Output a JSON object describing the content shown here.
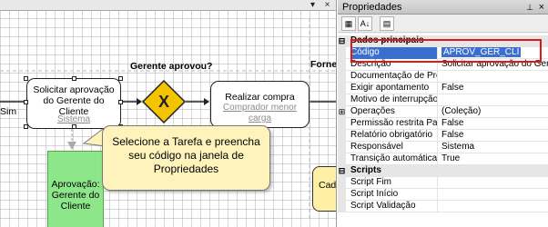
{
  "canvas": {
    "close_glyph": "×",
    "menu_glyph": "▾",
    "gateway_question": "Gerente aprovou?",
    "lane_left": "Sim",
    "lane_right": "Forne",
    "task1": {
      "title": "Solicitar aprovação do Gerente do Cliente",
      "subtitle": "Sistema"
    },
    "gateway_symbol": "X",
    "task2": {
      "title": "Realizar compra",
      "subtitle": "Comprador menor carga"
    },
    "green_box_label": "Aprovação: Gerente do Cliente",
    "callout_text": "Selecione a Tarefa e preencha seu código na janela de Propriedades",
    "yellow_task_label": "Cad"
  },
  "panel": {
    "title": "Propriedades",
    "pin_glyph": "📌",
    "close_glyph": "×",
    "toolbar": {
      "categorized_icon": "categorized-icon",
      "alphabetical_icon": "alphabetical-icon",
      "properties_icon": "property-pages-icon"
    },
    "categories": [
      {
        "name": "Dados principais",
        "expander": "⊟"
      },
      {
        "name": "Scripts",
        "expander": "⊟"
      }
    ],
    "rows": [
      {
        "name": "Código",
        "value": "APROV_GER_CLI",
        "selected": true
      },
      {
        "name": "Descrição",
        "value": "Solicitar aprovação do Gerente"
      },
      {
        "name": "Documentação de Proce",
        "value": ""
      },
      {
        "name": "Exigir apontamento",
        "value": "False"
      },
      {
        "name": "Motivo de interrupção d",
        "value": ""
      },
      {
        "name": "Operações",
        "value": "(Coleção)",
        "expander": "⊞"
      },
      {
        "name": "Permissão restrita Papel",
        "value": "False"
      },
      {
        "name": "Relatório obrigatório",
        "value": "False"
      },
      {
        "name": "Responsável",
        "value": "Sistema"
      },
      {
        "name": "Transição automática",
        "value": "True"
      }
    ],
    "script_rows": [
      {
        "name": "Script Fim",
        "value": ""
      },
      {
        "name": "Script Início",
        "value": ""
      },
      {
        "name": "Script Validação",
        "value": ""
      }
    ]
  },
  "colors": {
    "highlight": "#e01818",
    "selection": "#3a6fd0",
    "gateway": "#f5c400",
    "callout_fill": "#fff3bc",
    "green_task": "#8ee68a"
  }
}
